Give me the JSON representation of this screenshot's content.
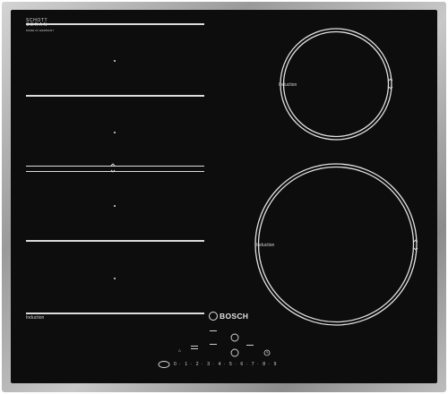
{
  "brand": {
    "logo_line1": "SCHOTT",
    "logo_line2": "CERAN",
    "logo_fine": "MADE IN GERMANY",
    "maker": "BOSCH"
  },
  "zones": {
    "flex_label": "Induction",
    "top_right_label": "Induction",
    "bottom_right_label": "Induction"
  },
  "controls": {
    "power_levels": [
      "0",
      "1",
      "2",
      "3",
      "4",
      "5",
      "6",
      "7",
      "8",
      "9"
    ],
    "timer_icon": "clock-icon",
    "lock_icon": "child-lock-icon",
    "power_icon": "power-icon"
  },
  "colors": {
    "glass": "#0d0d0d",
    "frame": "#b0b0b0",
    "print": "#dcdcdc"
  }
}
